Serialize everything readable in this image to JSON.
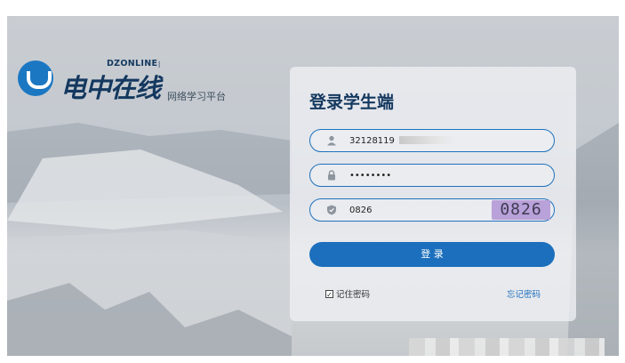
{
  "brand": {
    "name_cn": "电中在线",
    "name_en": "DZONLINE",
    "subtitle": "网络学习平台"
  },
  "login": {
    "title": "登录学生端",
    "username_value": "32128119",
    "password_value": "••••••••",
    "captcha_value": "0826",
    "captcha_image_text": "0826",
    "login_label": "登 录",
    "remember_label": "记住密码",
    "remember_checked": true,
    "forgot_label": "忘记密码"
  },
  "colors": {
    "accent": "#1b6fbc",
    "brand_dark": "#14385f"
  },
  "icons": {
    "user": "user-icon",
    "lock": "lock-icon",
    "shield": "shield-icon"
  }
}
